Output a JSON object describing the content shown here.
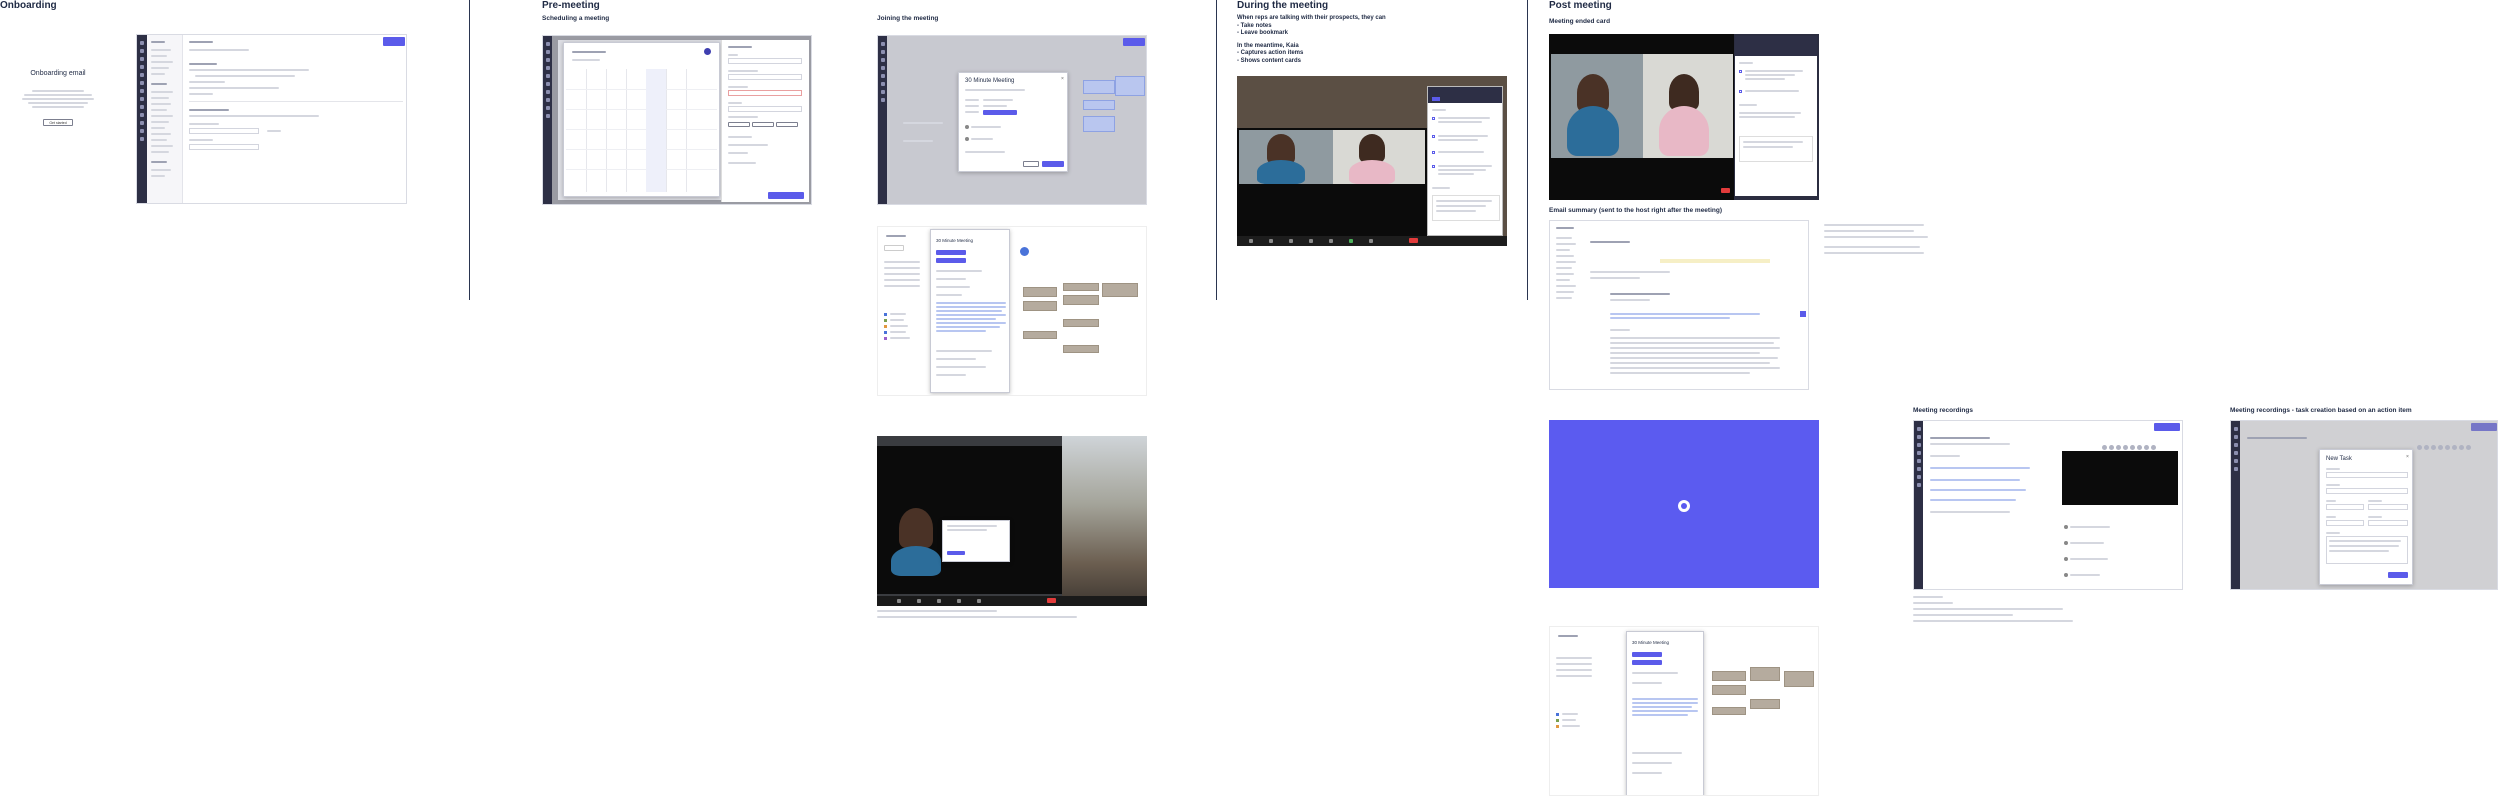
{
  "sections": {
    "onboarding": "Onboarding",
    "pre_meeting": "Pre-meeting",
    "during": "During the meeting",
    "post": "Post meeting"
  },
  "subtitles": {
    "scheduling": "Scheduling a meeting",
    "joining": "Joining the meeting",
    "meeting_ended": "Meeting ended card",
    "email_summary": "Email summary (sent to the host right after the meeting)",
    "recordings": "Meeting recordings",
    "recordings_task": "Meeting recordings - task creation based on an action item"
  },
  "onboarding_email": {
    "title": "Onboarding email",
    "button": "Get started"
  },
  "during_notes": {
    "intro": "When reps are talking with their prospects, they can",
    "items": [
      "- Take notes",
      "- Leave bookmark"
    ],
    "meantime_intro": "In the meantime, Kaia",
    "meantime_items": [
      "- Captures action items",
      "- Shows content cards"
    ]
  },
  "modals": {
    "minute_meeting": "30 Minute Meeting",
    "new_task": "New Task"
  },
  "colors": {
    "accent": "#5b5bea",
    "sidebar": "#2d2f45",
    "title": "#1f2a44",
    "meeting_block": "#b9c6ef",
    "tan_block": "#b5ab9e"
  }
}
